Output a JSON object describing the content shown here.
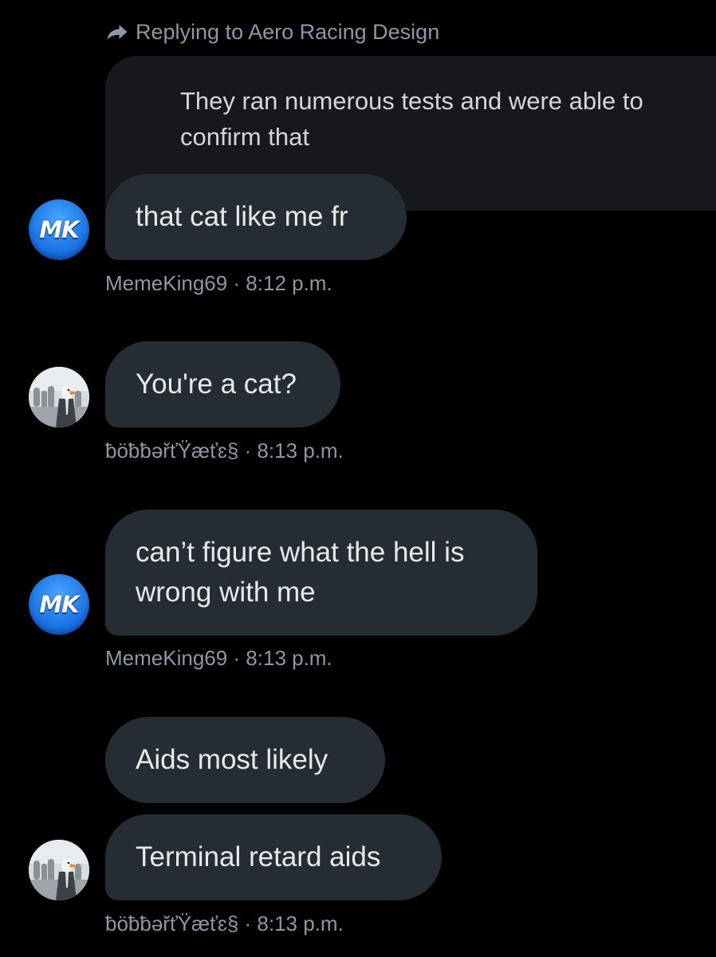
{
  "reply_header": {
    "label": "Replying to Aero Racing Design"
  },
  "quoted_message": {
    "text": "They ran numerous tests and were able to confirm that"
  },
  "messages": [
    {
      "text": "that cat like me fr",
      "author": "MemeKing69",
      "time": "8:12 p.m.",
      "meta": "MemeKing69 · 8:12 p.m.",
      "avatar": "mk-logo-avatar"
    },
    {
      "text": "You're a cat?",
      "author": "ƀöƀƀəřťŸæťɛ§",
      "time": "8:13 p.m.",
      "meta": "ƀöƀƀəřťŸæťɛ§ · 8:13 p.m.",
      "avatar": "suit-bird-avatar"
    },
    {
      "text": "can’t figure what the hell is wrong with me",
      "author": "MemeKing69",
      "time": "8:13 p.m.",
      "meta": "MemeKing69 · 8:13 p.m.",
      "avatar": "mk-logo-avatar"
    },
    {
      "text": "Aids most likely",
      "author": "ƀöƀƀəřťŸæťɛ§",
      "time": "",
      "meta": "",
      "avatar": ""
    },
    {
      "text": "Terminal retard aids",
      "author": "ƀöƀƀəřťŸæťɛ§",
      "time": "8:13 p.m.",
      "meta": "ƀöƀƀəřťŸæťɛ§ · 8:13 p.m.",
      "avatar": "suit-bird-avatar"
    }
  ],
  "avatars": {
    "mk_label": "MK"
  },
  "colors": {
    "background": "#000000",
    "bubble": "#252c33",
    "quoted_bubble": "#16181c",
    "meta_text": "#8b98a5",
    "message_text": "#e7e9ea",
    "mk_avatar_blue": "#1e78e6"
  }
}
